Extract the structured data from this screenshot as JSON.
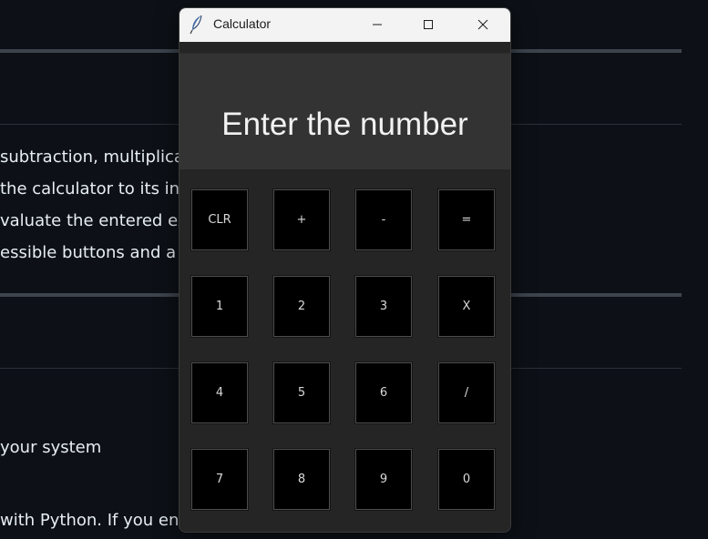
{
  "background": {
    "lines": [
      "subtraction, multiplicat",
      " the calculator to its ini",
      "valuate the entered ex",
      "essible buttons and a c",
      "your system",
      "with Python. If you enc"
    ]
  },
  "window": {
    "title": "Calculator",
    "app_icon": "feather-icon",
    "controls": [
      "minimize-icon",
      "maximize-icon",
      "close-icon"
    ]
  },
  "display": {
    "value": "Enter the number"
  },
  "keypad": {
    "rows": [
      [
        "CLR",
        "+",
        "-",
        "="
      ],
      [
        "1",
        "2",
        "3",
        "X"
      ],
      [
        "4",
        "5",
        "6",
        "/"
      ],
      [
        "7",
        "8",
        "9",
        "0"
      ]
    ]
  }
}
